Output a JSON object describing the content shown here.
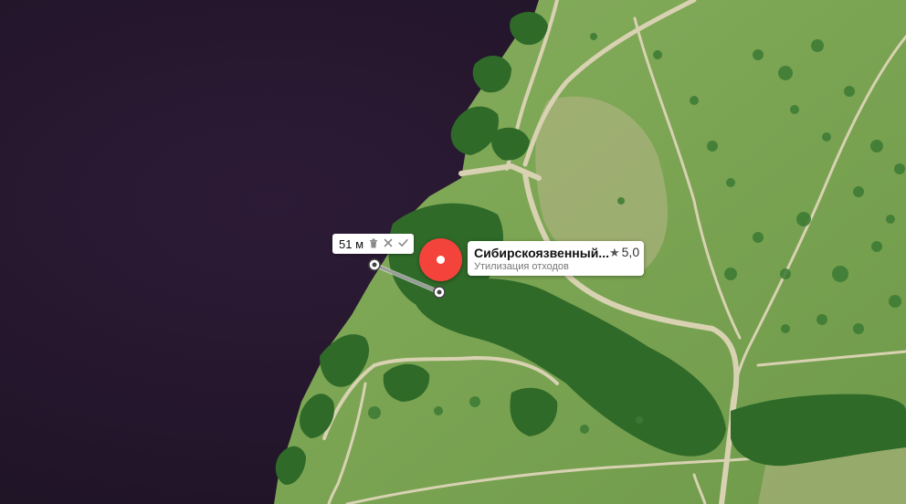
{
  "map": {
    "type": "satellite",
    "colors": {
      "water": "#27182e",
      "meadow": "#7ea654",
      "forest": "#3e7a33",
      "road": "#cfc7a8",
      "marker": "#f4433b"
    }
  },
  "ruler": {
    "distance": "51 м",
    "delete_icon": "trash-icon",
    "close_icon": "close-icon",
    "confirm_icon": "check-icon"
  },
  "poi": {
    "title": "Сибирскоязвенный...",
    "rating": "5,0",
    "rating_icon": "star-icon",
    "category": "Утилизация отходов",
    "marker_icon": "map-pin-icon"
  }
}
